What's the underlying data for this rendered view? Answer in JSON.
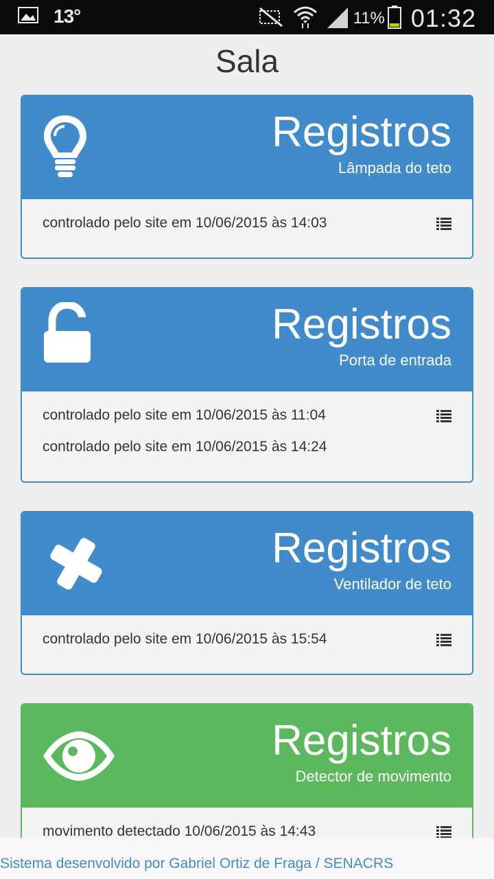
{
  "status_bar": {
    "temperature": "13°",
    "battery_percent": "11%",
    "time": "01:32"
  },
  "page": {
    "title": "Sala"
  },
  "cards": [
    {
      "title": "Registros",
      "subtitle": "Lâmpada do teto",
      "icon": "lightbulb-icon",
      "color": "#428bca",
      "entries": [
        "controlado pelo site em 10/06/2015 às 14:03"
      ]
    },
    {
      "title": "Registros",
      "subtitle": "Porta de entrada",
      "icon": "unlock-icon",
      "color": "#428bca",
      "entries": [
        "controlado pelo site em 10/06/2015 às 11:04",
        "controlado pelo site em 10/06/2015 às 14:24"
      ]
    },
    {
      "title": "Registros",
      "subtitle": "Ventilador de teto",
      "icon": "fan-icon",
      "color": "#428bca",
      "entries": [
        "controlado pelo site em 10/06/2015 às 15:54"
      ]
    },
    {
      "title": "Registros",
      "subtitle": "Detector de movimento",
      "icon": "eye-icon",
      "color": "#5cb85c",
      "entries": [
        "movimento detectado 10/06/2015 às 14:43"
      ]
    }
  ],
  "footer": {
    "text": "Sistema desenvolvido por Gabriel Ortiz de Fraga / SENACRS"
  }
}
